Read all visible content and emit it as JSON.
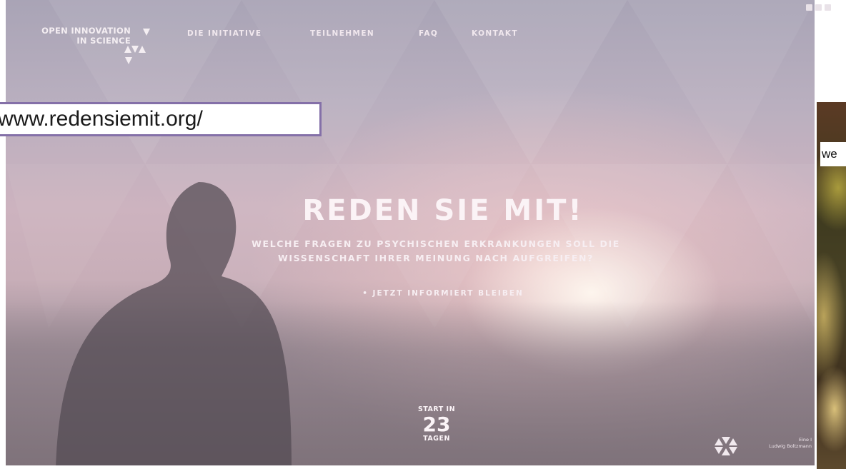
{
  "header": {
    "logo_line1": "OPEN INNOVATION",
    "logo_line2": "IN SCIENCE",
    "nav": [
      "DIE INITIATIVE",
      "TEILNEHMEN",
      "FAQ",
      "KONTAKT"
    ]
  },
  "url_annotation": "www.redensiemit.org/",
  "hero": {
    "headline": "REDEN SIE MIT!",
    "subline_1": "WELCHE FRAGEN ZU PSYCHISCHEN ERKRANKUNGEN SOLL DIE",
    "subline_2": "WISSENSCHAFT IHRER MEINUNG NACH AUFGREIFEN?",
    "cta": "• JETZT INFORMIERT BLEIBEN"
  },
  "countdown": {
    "label": "START IN",
    "number": "23",
    "unit": "TAGEN"
  },
  "footer": {
    "line1": "Eine I",
    "line2": "Ludwig Boltzmann"
  },
  "side_photo_label": "we",
  "colors": {
    "url_border": "#8470a8",
    "hero_tint": "#c8aeb8"
  }
}
